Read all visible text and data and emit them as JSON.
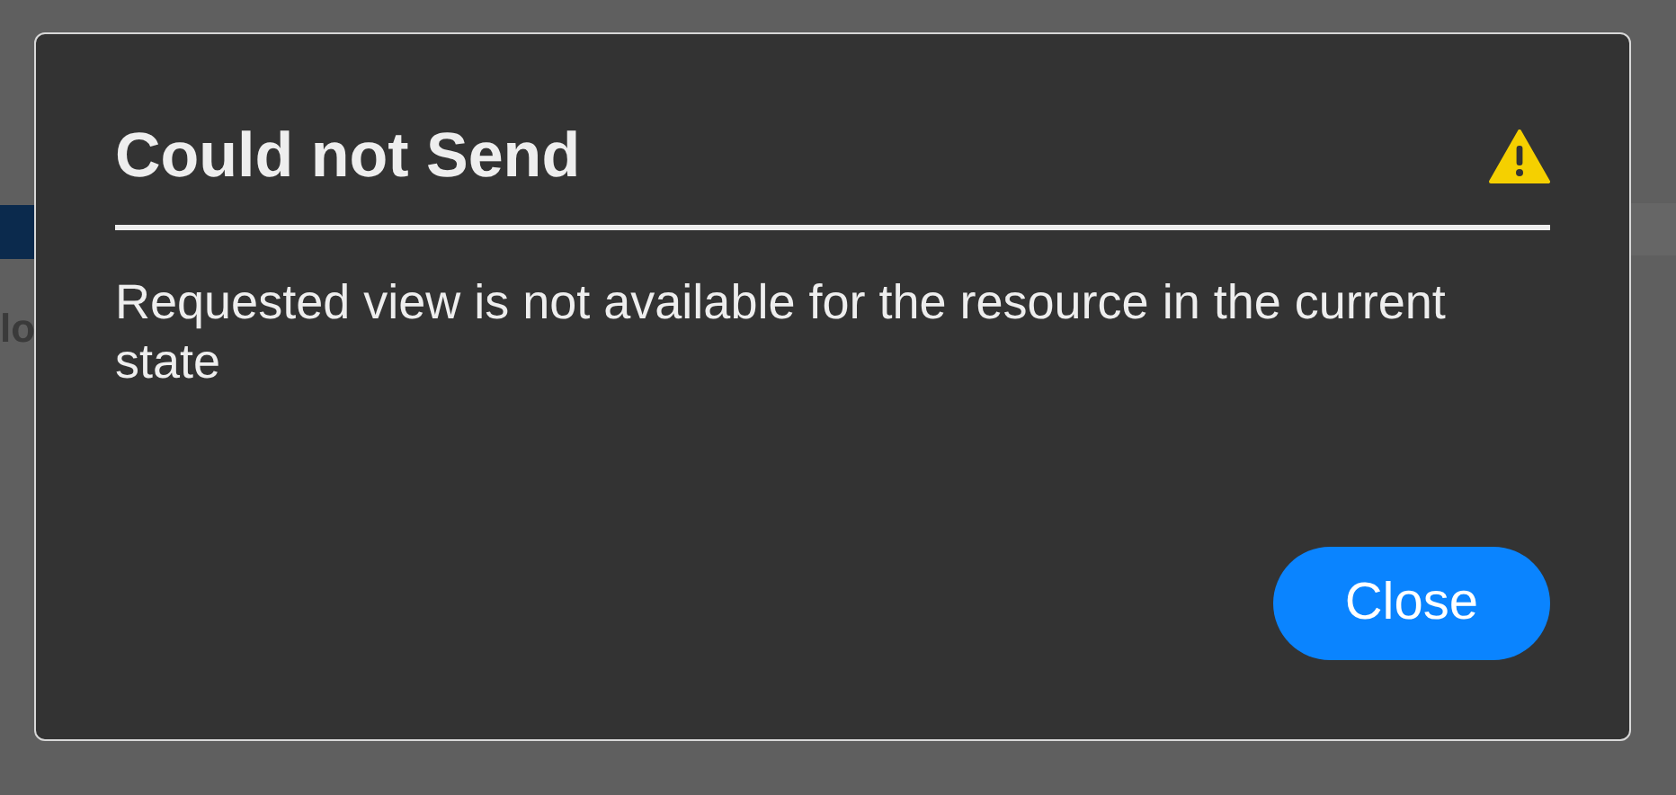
{
  "background": {
    "text_fragment": "lo"
  },
  "dialog": {
    "title": "Could not Send",
    "message": "Requested view is not available for the resource in the current state",
    "buttons": [
      {
        "label": "Close",
        "kind": "primary"
      }
    ]
  }
}
